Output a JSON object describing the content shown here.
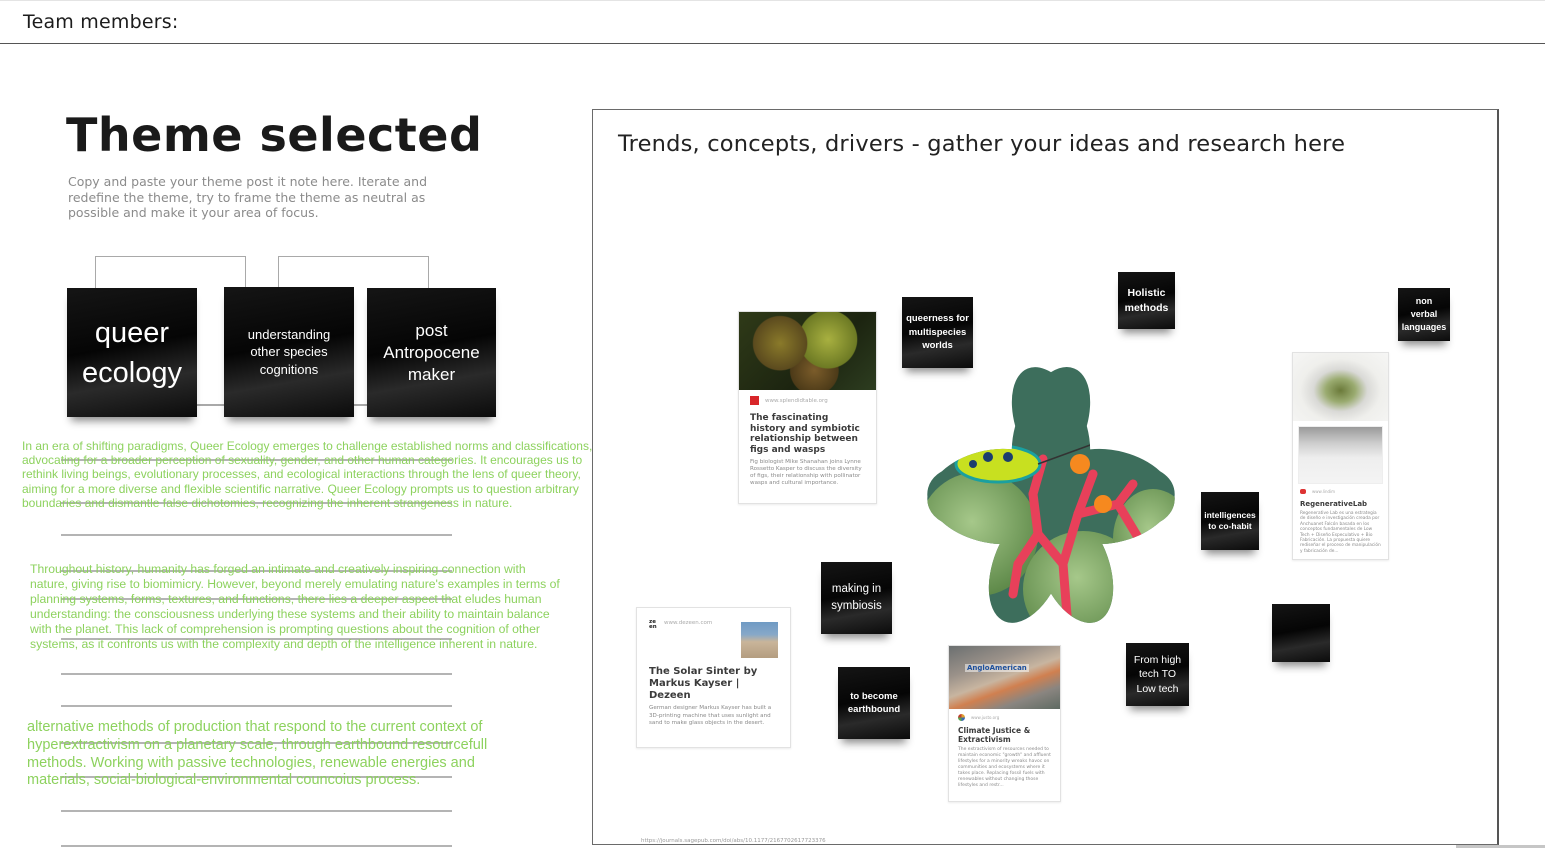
{
  "header": {
    "label": "Team members:"
  },
  "theme": {
    "title": "Theme selected",
    "instructions": "Copy and paste your theme post it note here. Iterate and redefine the theme, try to frame the theme as neutral as possible and make it your area of focus.",
    "notes": [
      {
        "text": "queer ecology"
      },
      {
        "text": "understanding other species cognitions"
      },
      {
        "text": "post Antropocene maker"
      }
    ],
    "paragraphs": [
      "In an era of shifting paradigms, Queer Ecology emerges to challenge established norms and classifications, advocating for a broader perception of sexuality, gender, and other human categories. It encourages us to rethink living beings, evolutionary processes, and ecological interactions through the lens of queer theory, aiming for a more diverse and flexible scientific narrative. Queer Ecology prompts us to question arbitrary boundaries and dismantle false dichotomies, recognizing the inherent strangeness in nature.",
      "Throughout history, humanity has forged an intimate and creatively inspiring connection with nature, giving rise to biomimicry. However, beyond merely emulating nature's examples in terms of planning systems, forms, textures, and functions, there lies a deeper aspect that eludes human understanding: the consciousness underlying these systems and their ability to maintain balance with the planet. This lack of comprehension is prompting questions about the cognition of other systems, as it confronts us with the complexity and depth of the intelligence inherent in nature.",
      "alternative methods of production that respond to the current context of hyperextractivism on a planetary scale, through earthbound resourcefull methods. Working with passive technologies, renewable energies and materials, social-biological-environmental councoius process."
    ],
    "accent_color": "#8dd25e"
  },
  "board": {
    "title": "Trends, concepts, drivers - gather your ideas and research here",
    "stickies": {
      "queerness": "queerness for multispecies worlds",
      "holistic": "Holistic methods",
      "nonverbal": "non verbal languages",
      "intelligences": "intelligences to co-habit",
      "symbiosis": "making in symbiosis",
      "earthbound": "to become earthbound",
      "lowtech": "From high tech TO Low tech",
      "blank": ""
    },
    "cards": {
      "figs": {
        "source": "www.splendidtable.org",
        "title": "The fascinating history and symbiotic relationship between figs and wasps",
        "description": "Fig biologist Mike Shanahan joins Lynne Rossetto Kasper to discuss the diversity of figs, their relationship with pollinator wasps and cultural importance."
      },
      "regen": {
        "source": "www.lindim",
        "title": "RegenerativeLab",
        "description": "Regenerative Lab es una estrategia de diseño e investigación creada por Anchuanet Falcón basada en los conceptos fundamentales de Low Tech + Diseño Especulativo + Bio Fabricación. La propuesta quiere rediseñar el proceso de manipulación y fabricación de..."
      },
      "dezeen": {
        "source": "www.dezeen.com",
        "favicon_text": "ze en",
        "title": "The Solar Sinter by Markus Kayser | Dezeen",
        "description": "German designer Markus Kayser has built a 3D-printing machine that uses sunlight and sand to make glass objects in the desert."
      },
      "climate": {
        "source": "www.justo.org",
        "image_banner": "AngloAmerican",
        "title": "Climate Justice & Extractivism",
        "description": "The extractivism of resources needed to maintain economic \"growth\" and affluent lifestyles for a minority wreaks havoc on communities and ecosystems where it takes place. Replacing fossil fuels with renewables without changing those lifestyles and restr..."
      }
    },
    "image_alt": "jewel bug on green fruit with red coral flowers",
    "footer_url": "https://journals.sagepub.com/doi/abs/10.1177/2167702617723376"
  }
}
